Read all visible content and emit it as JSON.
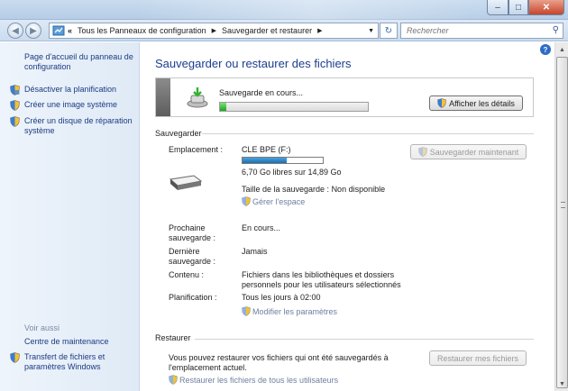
{
  "addressbar": {
    "back_icon": "back-arrow-icon",
    "forward_icon": "forward-arrow-icon",
    "overflow": "«",
    "breadcrumb": [
      "Tous les Panneaux de configuration",
      "Sauvegarder et restaurer"
    ],
    "search_placeholder": "Rechercher"
  },
  "sidebar": {
    "home": "Page d'accueil du panneau de configuration",
    "tasks": [
      "Désactiver la planification",
      "Créer une image système",
      "Créer un disque de réparation système"
    ],
    "see_also_title": "Voir aussi",
    "see_also": [
      "Centre de maintenance",
      "Transfert de fichiers et paramètres Windows"
    ]
  },
  "main": {
    "title": "Sauvegarder ou restaurer des fichiers",
    "progress": {
      "label": "Sauvegarde en cours...",
      "fraction": 0.04,
      "details_button": "Afficher les détails",
      "accent": "#2db52d"
    },
    "backup": {
      "section": "Sauvegarder",
      "location_label": "Emplacement :",
      "location_value": "CLE BPE (F:)",
      "capacity_used_fraction": 0.55,
      "capacity_text": "6,70 Go libres sur 14,89 Go",
      "size_text": "Taille de la sauvegarde : Non disponible",
      "manage_space": "Gérer l'espace",
      "backup_now_button": "Sauvegarder maintenant",
      "next_label": "Prochaine sauvegarde :",
      "next_value": "En cours...",
      "last_label": "Dernière sauvegarde :",
      "last_value": "Jamais",
      "contents_label": "Contenu :",
      "contents_value": "Fichiers dans les bibliothèques et dossiers personnels pour les utilisateurs sélectionnés",
      "schedule_label": "Planification :",
      "schedule_value": "Tous les jours à 02:00",
      "change_settings": "Modifier les paramètres"
    },
    "restore": {
      "section": "Restaurer",
      "text": "Vous pouvez restaurer vos fichiers qui ont été sauvegardés à l'emplacement actuel.",
      "restore_button": "Restaurer mes fichiers",
      "restore_all_link": "Restaurer les fichiers de tous les utilisateurs"
    }
  },
  "colors": {
    "link": "#1c3a82",
    "title": "#1b3d8f",
    "disabled_link": "#6e7fa0"
  }
}
